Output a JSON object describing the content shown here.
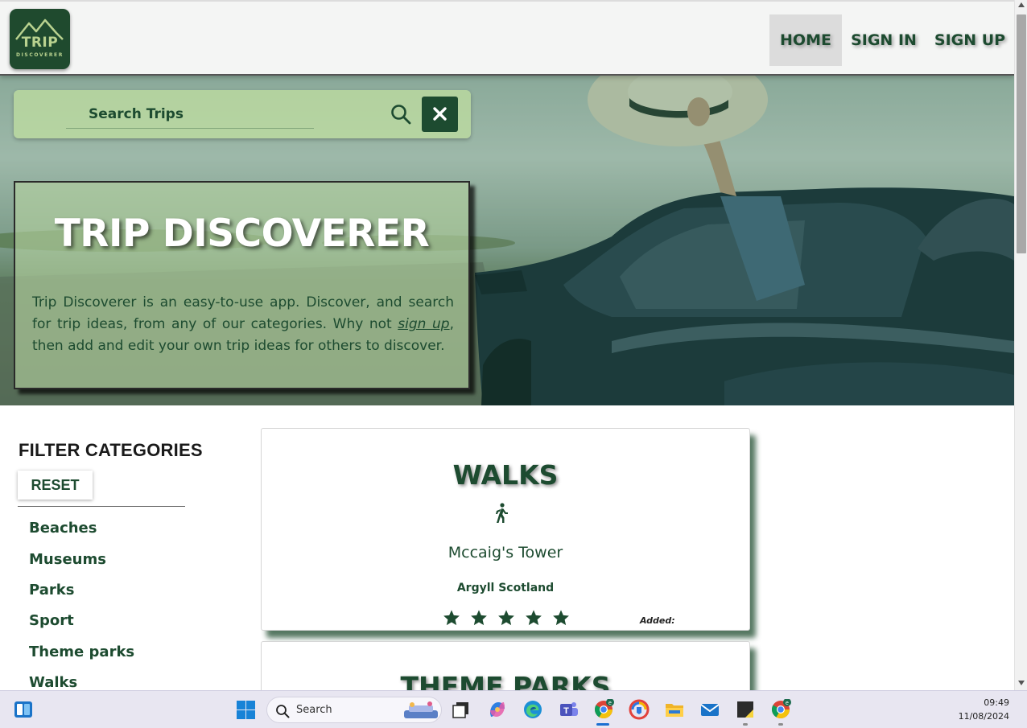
{
  "logo": {
    "line1": "TRIP",
    "line2": "DISCOVERER"
  },
  "nav": {
    "home": "HOME",
    "sign_in": "SIGN IN",
    "sign_up": "SIGN UP"
  },
  "search": {
    "placeholder": "Search Trips",
    "search_icon": "search-icon",
    "clear_icon": "close-icon"
  },
  "intro": {
    "title": "TRIP DISCOVERER",
    "text_before": "Trip Discoverer is an easy-to-use app. Discover, and search for trip ideas, from any of our categories. Why not ",
    "link": "sign up",
    "text_after": ", then add and edit your own trip ideas for others to discover."
  },
  "filters": {
    "title": "FILTER CATEGORIES",
    "reset": "RESET",
    "items": [
      "Beaches",
      "Museums",
      "Parks",
      "Sport",
      "Theme parks",
      "Walks"
    ]
  },
  "cards": [
    {
      "category": "WALKS",
      "icon": "walking-person-icon",
      "name": "Mccaig's Tower",
      "location": "Argyll Scotland",
      "rating": 5,
      "added_label": "Added:"
    },
    {
      "category": "THEME PARKS"
    }
  ],
  "taskbar": {
    "search_label": "Search",
    "time": "09:49",
    "date": "11/08/2024",
    "apps": [
      "task-view-icon",
      "copilot-icon",
      "edge-icon",
      "teams-icon",
      "chrome-icon",
      "vpn-icon",
      "file-explorer-icon",
      "mail-icon",
      "sticky-notes-icon",
      "chrome-profile-icon"
    ]
  },
  "colors": {
    "brand_green": "#1d4b30",
    "nav_active_bg": "#dcdcdc",
    "star": "#1d4b30"
  }
}
